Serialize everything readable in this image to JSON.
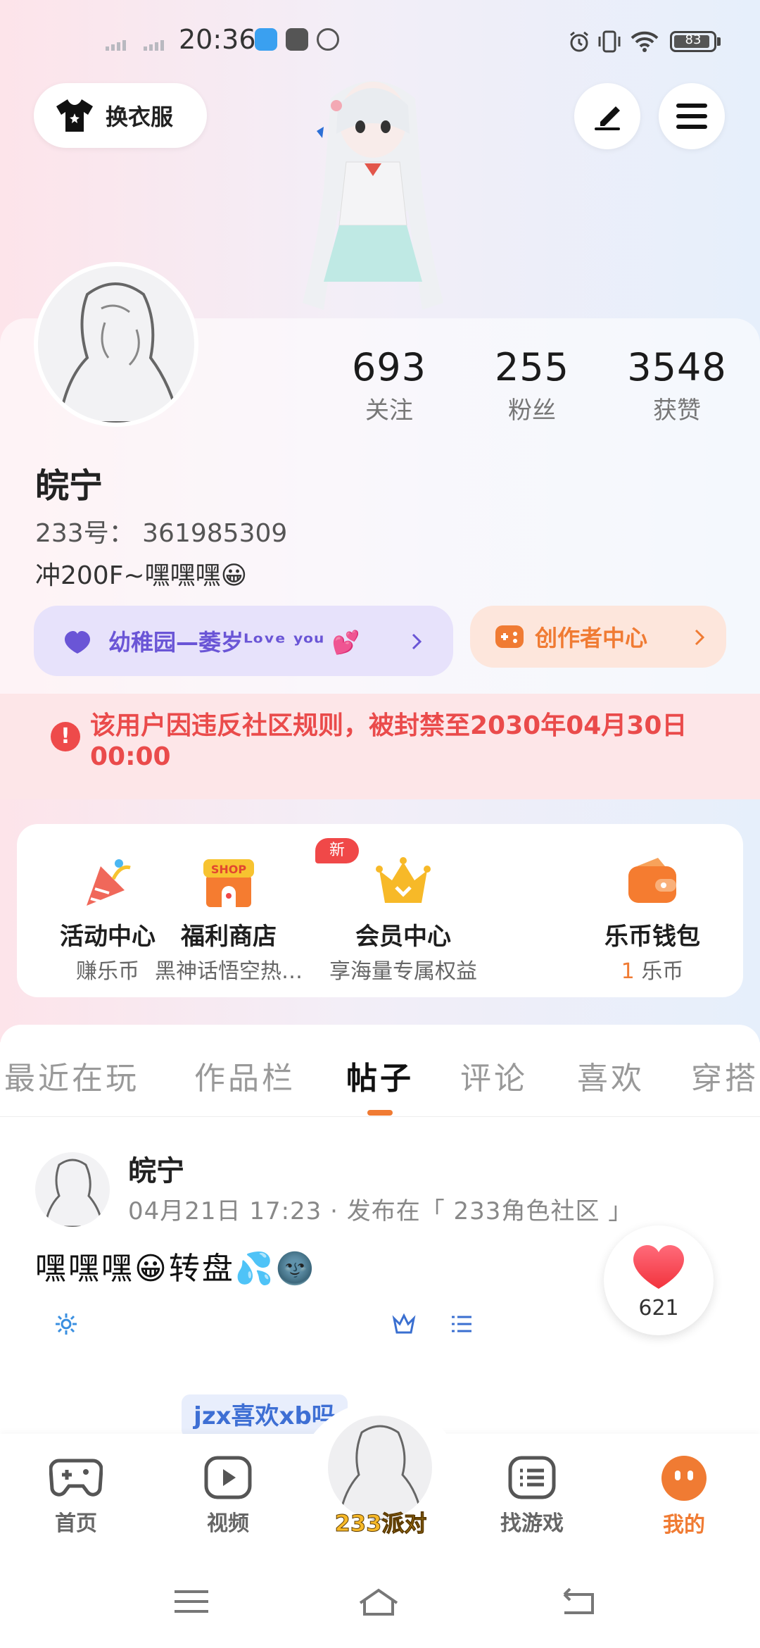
{
  "status_bar": {
    "time": "20:36",
    "battery": "83"
  },
  "header": {
    "outfit_label": "换衣服"
  },
  "profile": {
    "name": "皖宁",
    "uid": "233号： 361985309",
    "bio": "冲200F~嘿嘿嘿😀",
    "stats": [
      {
        "value": "693",
        "label": "关注"
      },
      {
        "value": "255",
        "label": "粉丝"
      },
      {
        "value": "3548",
        "label": "获赞"
      }
    ]
  },
  "badges": {
    "group": "幼稚园—萎岁ᴸᵒᵛᵉ ʸᵒᵘ 💕",
    "creator": "创作者中心"
  },
  "ban_notice": "该用户因违反社区规则，被封禁至2030年04月30日 00:00",
  "services": [
    {
      "title": "活动中心",
      "sub": "赚乐币"
    },
    {
      "title": "福利商店",
      "sub": "黑神话悟空热…"
    },
    {
      "title": "会员中心",
      "sub": "享海量专属权益"
    },
    {
      "title": "乐币钱包",
      "sub_num": "1",
      "sub": "乐币"
    }
  ],
  "shop_icon_text": "SHOP",
  "new_tag": "新",
  "tabs": [
    "最近在玩",
    "作品栏",
    "帖子",
    "评论",
    "喜欢",
    "穿搭"
  ],
  "post": {
    "author": "皖宁",
    "meta": "04月21日 17:23 · 发布在「 233角色社区 」",
    "text": "嘿嘿嘿😀转盘💦🌚",
    "likes": "621"
  },
  "floating_tag": "jzx喜欢xb吗",
  "bottom_nav": [
    {
      "label": "首页"
    },
    {
      "label": "视频"
    },
    {
      "label": "233派对"
    },
    {
      "label": "找游戏"
    },
    {
      "label": "我的"
    }
  ],
  "colors": {
    "accent": "#f07b33",
    "ban": "#ea4b4b",
    "purple": "#6a55d6"
  }
}
